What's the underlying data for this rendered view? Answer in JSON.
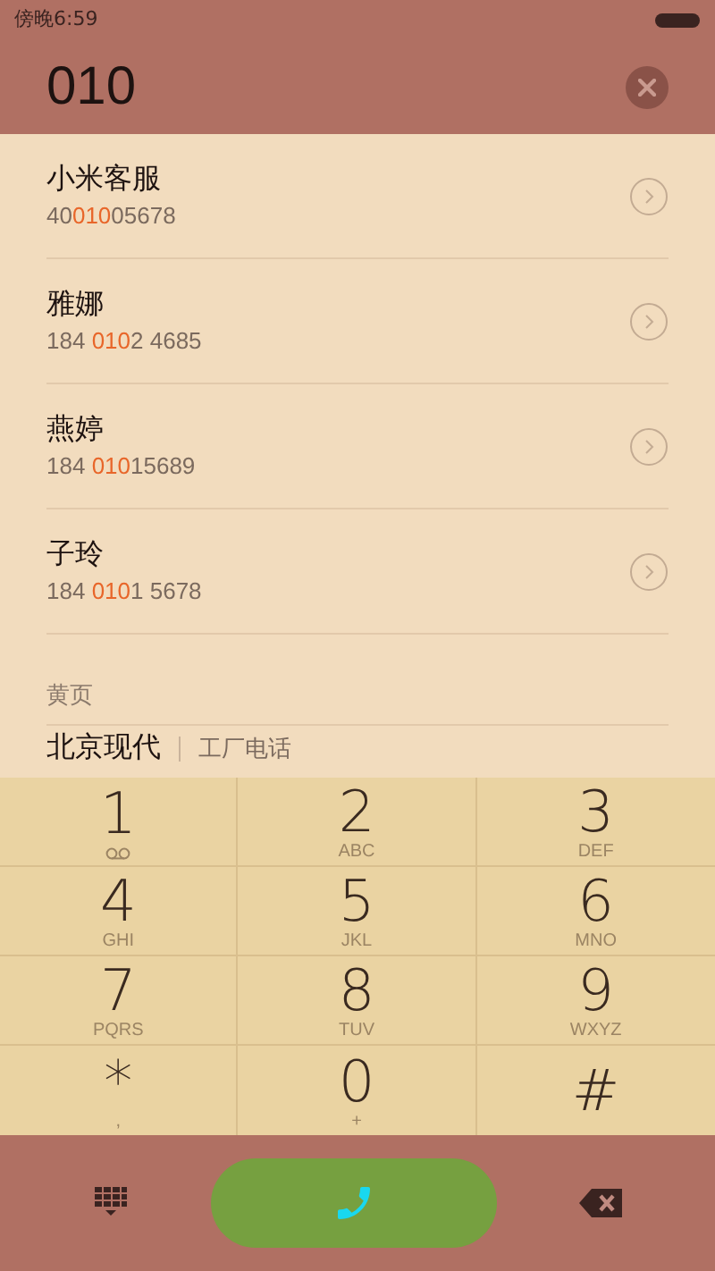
{
  "status_bar": {
    "time": "傍晚6:59"
  },
  "dial_input": {
    "value": "010"
  },
  "results": [
    {
      "name": "小米客服",
      "number_prefix": "40",
      "number_match": "010",
      "number_suffix": "05678"
    },
    {
      "name": "雅娜",
      "number_prefix": "184 ",
      "number_match": "010",
      "number_suffix": "2 4685"
    },
    {
      "name": "燕婷",
      "number_prefix": "184 ",
      "number_match": "010",
      "number_suffix": "15689"
    },
    {
      "name": "子玲",
      "number_prefix": "184 ",
      "number_match": "010",
      "number_suffix": "1 5678"
    }
  ],
  "yellow_pages": {
    "heading": "黄页",
    "entries": [
      {
        "name": "北京现代",
        "detail": "工厂电话"
      }
    ]
  },
  "keypad": [
    {
      "digit": "1",
      "kind": "voicemail"
    },
    {
      "digit": "2",
      "letters": "ABC",
      "kind": "letters"
    },
    {
      "digit": "3",
      "letters": "DEF",
      "kind": "letters"
    },
    {
      "digit": "4",
      "letters": "GHI",
      "kind": "letters"
    },
    {
      "digit": "5",
      "letters": "JKL",
      "kind": "letters"
    },
    {
      "digit": "6",
      "letters": "MNO",
      "kind": "letters"
    },
    {
      "digit": "7",
      "letters": "PQRS",
      "kind": "letters"
    },
    {
      "digit": "8",
      "letters": "TUV",
      "kind": "letters"
    },
    {
      "digit": "9",
      "letters": "WXYZ",
      "kind": "letters"
    },
    {
      "digit": "*",
      "letters": ",",
      "kind": "letters"
    },
    {
      "digit": "0",
      "letters": "+",
      "kind": "letters"
    },
    {
      "digit": "#",
      "kind": "plain"
    }
  ]
}
